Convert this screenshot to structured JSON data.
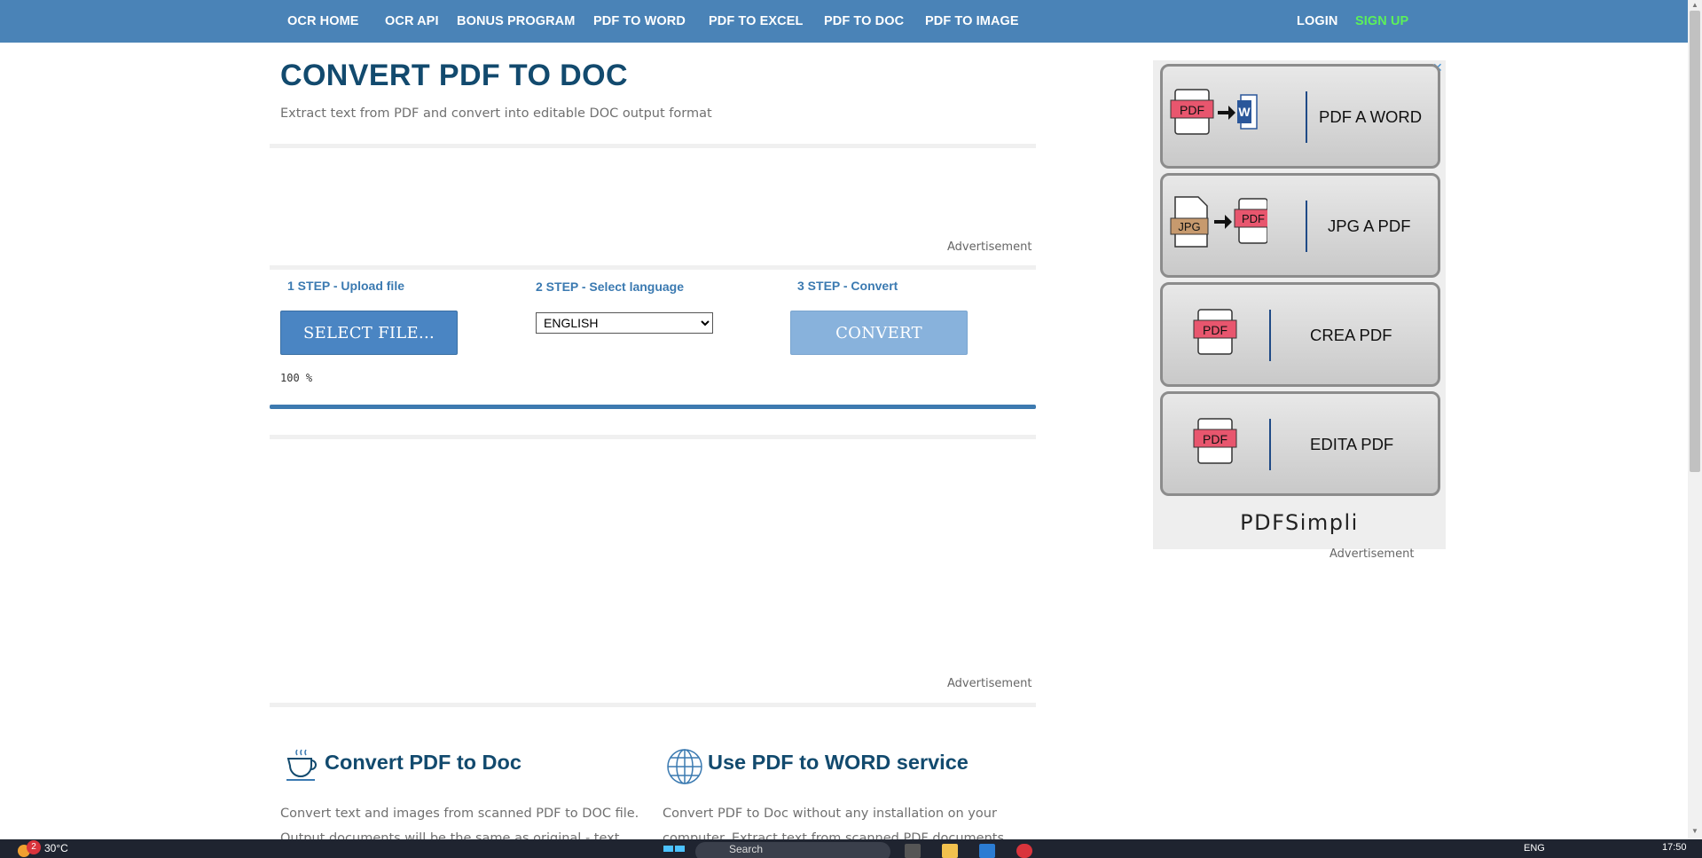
{
  "nav": {
    "items": [
      {
        "label": "OCR HOME"
      },
      {
        "label": "OCR API"
      },
      {
        "label": "BONUS PROGRAM"
      },
      {
        "label": "PDF TO WORD"
      },
      {
        "label": "PDF TO EXCEL"
      },
      {
        "label": "PDF TO DOC"
      },
      {
        "label": "PDF TO IMAGE"
      }
    ],
    "login": "LOGIN",
    "signup": "SIGN UP"
  },
  "header": {
    "title": "CONVERT PDF TO DOC",
    "subtitle": "Extract text from PDF and convert into editable DOC output format"
  },
  "ads": {
    "label": "Advertisement"
  },
  "steps": {
    "step1": "1 STEP - Upload file",
    "step2": "2 STEP - Select language",
    "step3": "3 STEP - Convert",
    "select_file_label": "SELECT FILE...",
    "language_selected": "ENGLISH",
    "convert_label": "CONVERT",
    "progress_text": "100 %",
    "progress_value": 100
  },
  "features": [
    {
      "title": "Convert PDF to Doc",
      "text": "Convert text and images from scanned PDF to DOC file. Output documents will be the same as original - text"
    },
    {
      "title": "Use PDF to WORD service",
      "text": "Convert PDF to Doc without any installation on your computer. Extract text from scanned PDF documents"
    }
  ],
  "side_ad": {
    "tiles": [
      {
        "label": "PDF A WORD",
        "icon": "pdf-to-word-icon"
      },
      {
        "label": "JPG A PDF",
        "icon": "jpg-to-pdf-icon"
      },
      {
        "label": "CREA PDF",
        "icon": "pdf-file-icon"
      },
      {
        "label": "EDITA PDF",
        "icon": "pdf-file-icon"
      }
    ],
    "brand": "PDFSimpli",
    "label": "Advertisement"
  },
  "taskbar": {
    "weather": "30°C",
    "notification_count": "2",
    "search_placeholder": "Search",
    "language": "ENG",
    "time": "17:50"
  },
  "colors": {
    "nav_bg": "#4a83b7",
    "title": "#124a6e",
    "signup": "#5cf05a",
    "button_primary": "#4a85c3",
    "button_disabled": "#88b2dc"
  }
}
